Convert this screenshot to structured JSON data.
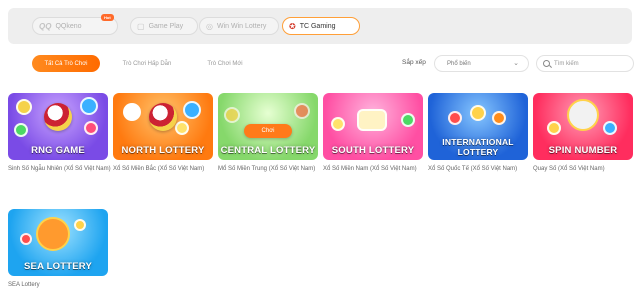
{
  "providers": [
    {
      "label": "QQkeno",
      "icon": "qq-logo-icon",
      "active": false,
      "badge": "Hot"
    },
    {
      "label": "Game Play",
      "icon": "gameplay-logo-icon",
      "active": false
    },
    {
      "label": "Win Win Lottery",
      "icon": "winwin-logo-icon",
      "active": false
    },
    {
      "label": "TC Gaming",
      "icon": "tc-gaming-logo-icon",
      "active": true
    }
  ],
  "tabs": [
    {
      "label": "Tất Cả Trò Chơi",
      "active": true
    },
    {
      "label": "Trò Chơi Hấp Dẫn",
      "active": false
    },
    {
      "label": "Trò Chơi Mới",
      "active": false
    }
  ],
  "sort": {
    "label": "Sắp xếp",
    "value": "Phổ biến"
  },
  "search": {
    "placeholder": "Tìm kiếm"
  },
  "play_label": "Chơi",
  "games": [
    {
      "title": "RNG GAME",
      "name": "Sinh Số Ngẫu Nhiên (Xổ Số Việt Nam)",
      "color": "#8a5cf0"
    },
    {
      "title": "NORTH LOTTERY",
      "name": "Xổ Số Miền Bắc (Xổ Số Việt Nam)",
      "color": "#ff8c1a"
    },
    {
      "title": "CENTRAL LOTTERY",
      "name": "Mổ Số Miền Trung (Xổ Số Việt Nam)",
      "color": "#9fe07a"
    },
    {
      "title": "SOUTH LOTTERY",
      "name": "Xổ Số Miền Nam (Xổ Số Việt Nam)",
      "color": "#ff5fae"
    },
    {
      "title": "INTERNATIONAL LOTTERY",
      "name": "Xổ Số Quốc Tế (Xổ Số Việt Nam)",
      "color": "#2f7ff0"
    },
    {
      "title": "SPIN NUMBER",
      "name": "Quay Số (Xổ Số Việt Nam)",
      "color": "#ff3b6b"
    },
    {
      "title": "SEA LOTTERY",
      "name": "SEA Lottery",
      "color": "#38b7ff"
    }
  ]
}
